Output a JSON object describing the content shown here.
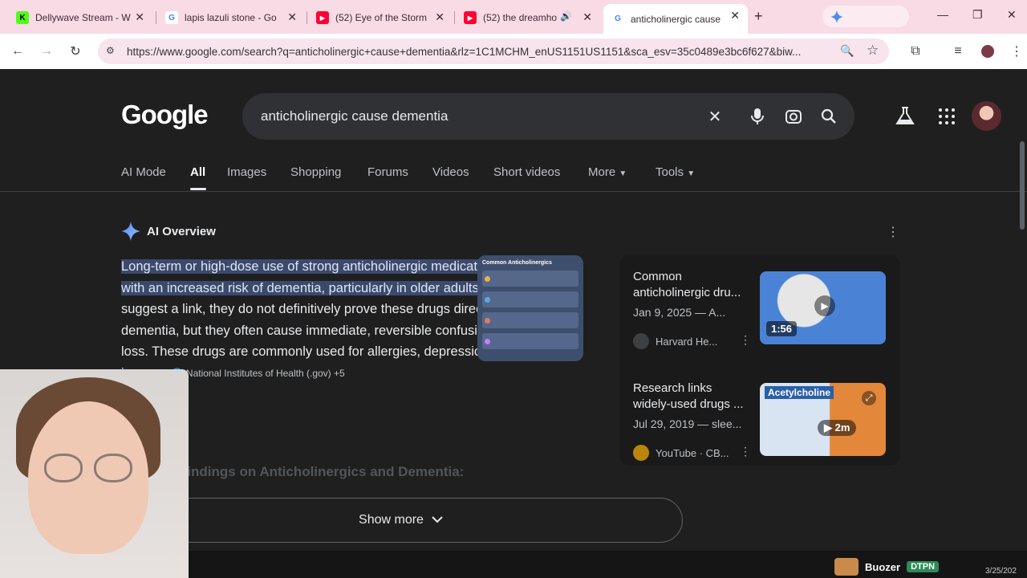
{
  "browser": {
    "tabs": [
      {
        "title": "Dellywave Stream - W",
        "favicon": "K",
        "fav_color": "#53fc18",
        "fav_text_color": "#000"
      },
      {
        "title": "lapis lazuli stone - Go",
        "favicon": "G",
        "fav_color": "#ffffff",
        "fav_text_color": "#4285f4"
      },
      {
        "title": "(52) Eye of the Storm",
        "favicon": "▶",
        "fav_color": "#ff0033",
        "fav_text_color": "#fff"
      },
      {
        "title": "(52) the dreamho",
        "favicon": "▶",
        "fav_color": "#ff0033",
        "fav_text_color": "#fff"
      },
      {
        "title": "anticholinergic cause",
        "favicon": "G",
        "fav_color": "#ffffff",
        "fav_text_color": "#4285f4"
      }
    ],
    "new_tab": "+",
    "url": "https://www.google.com/search?q=anticholinergic+cause+dementia&rlz=1C1MCHM_enUS1151US1151&sca_esv=35c0489e3bc6f627&biw..."
  },
  "google": {
    "logo": "Google",
    "query": "anticholinergic cause dementia",
    "tabs": [
      "AI Mode",
      "All",
      "Images",
      "Shopping",
      "Forums",
      "Videos",
      "Short videos",
      "More",
      "Tools"
    ],
    "active_tab": "All"
  },
  "ai_overview": {
    "heading": "AI Overview",
    "highlighted": "Long-term or high-dose use of strong anticholinergic medications is associated with an increased risk of dementia, particularly in older adults",
    "text_1": ". While studies suggest a link, they do not definitively prove these drugs directly ",
    "text_italic": "cause",
    "text_2": " dementia, but they often cause immediate, reversible confusion and memory loss. These drugs are commonly used for allergies, depression, and bladder issues.",
    "source": "National Institutes of Health (.gov) +5",
    "findings_heading": "Key Findings on Anticholinergics and Dementia:",
    "thumb_title": "Common Anticholinergics",
    "show_more": "Show more"
  },
  "videos": [
    {
      "title": "Common anticholinergic dru...",
      "date": "Jan 9, 2025 — A...",
      "source": "Harvard He...",
      "duration": "1:56"
    },
    {
      "title": "Research links widely-used drugs ...",
      "date": "Jul 29, 2019 — slee...",
      "source": "YouTube · CB...",
      "duration": "2m",
      "thumb_label": "Acetylcholine"
    }
  ],
  "overlay": {
    "name": "Buozer",
    "badge": "DTPN",
    "date": "3/25/202"
  }
}
